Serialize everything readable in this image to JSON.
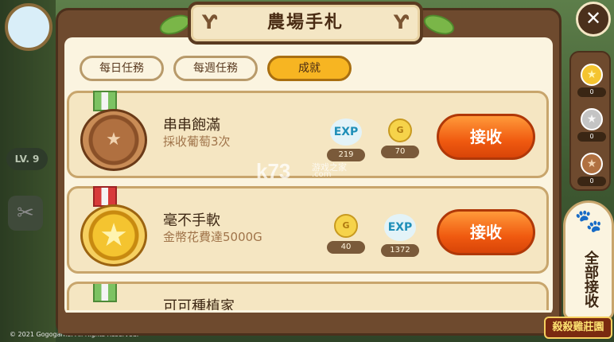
{
  "background": {
    "level_label": "LV. 9",
    "copyright": "© 2021 Gogogame. All Rights Reserved."
  },
  "panel": {
    "title": "農場手札",
    "tabs": [
      {
        "label": "每日任務",
        "active": false
      },
      {
        "label": "每週任務",
        "active": false
      },
      {
        "label": "成就",
        "active": true
      }
    ]
  },
  "achievements": [
    {
      "title": "串串飽滿",
      "description": "採收葡萄3次",
      "medal": "bronze",
      "rewards": [
        {
          "type": "EXP",
          "value": "219"
        },
        {
          "type": "G",
          "value": "70"
        }
      ],
      "claim_label": "接收"
    },
    {
      "title": "毫不手軟",
      "description": "金幣花費達5000G",
      "medal": "gold",
      "rewards": [
        {
          "type": "G",
          "value": "40"
        },
        {
          "type": "EXP",
          "value": "1372"
        }
      ],
      "claim_label": "接收"
    },
    {
      "title": "可可種植家",
      "medal": "bronze"
    }
  ],
  "sidebar": {
    "medals": [
      {
        "type": "gold",
        "count": "0"
      },
      {
        "type": "silver",
        "count": "0"
      },
      {
        "type": "bronze",
        "count": "0"
      }
    ]
  },
  "claim_all": {
    "label": "全部接收"
  },
  "game_logo": "殺殺雞莊園",
  "watermark": {
    "main": "k73",
    "sub": "游戏之家",
    "domain": ".com"
  },
  "colors": {
    "panel_brown": "#6e4a2e",
    "claim_orange": "#f05a10",
    "tab_active": "#f7b522",
    "exp_blue": "#1f8fb8"
  }
}
